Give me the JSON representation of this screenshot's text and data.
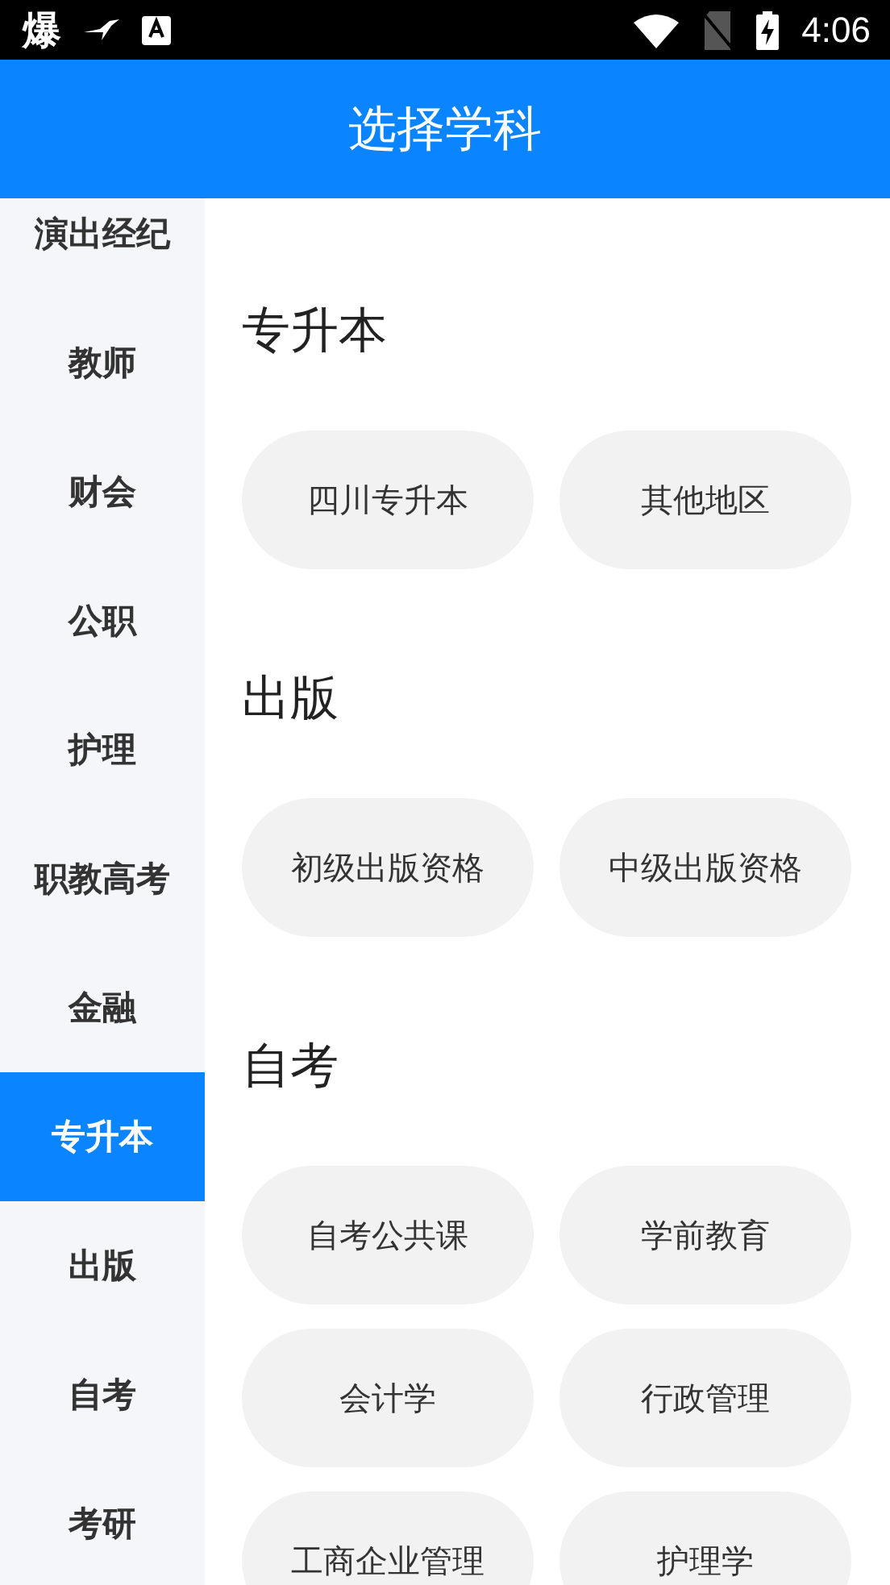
{
  "status_bar": {
    "notification_glyph": "爆",
    "time": "4:06"
  },
  "header": {
    "title": "选择学科"
  },
  "sidebar": {
    "items": [
      {
        "label": "演出经纪",
        "selected": false
      },
      {
        "label": "教师",
        "selected": false
      },
      {
        "label": "财会",
        "selected": false
      },
      {
        "label": "公职",
        "selected": false
      },
      {
        "label": "护理",
        "selected": false
      },
      {
        "label": "职教高考",
        "selected": false
      },
      {
        "label": "金融",
        "selected": false
      },
      {
        "label": "专升本",
        "selected": true
      },
      {
        "label": "出版",
        "selected": false
      },
      {
        "label": "自考",
        "selected": false
      },
      {
        "label": "考研",
        "selected": false
      }
    ]
  },
  "sections": [
    {
      "title": "专升本",
      "subjects": [
        "四川专升本",
        "其他地区"
      ]
    },
    {
      "title": "出版",
      "subjects": [
        "初级出版资格",
        "中级出版资格"
      ]
    },
    {
      "title": "自考",
      "subjects": [
        "自考公共课",
        "学前教育",
        "会计学",
        "行政管理",
        "工商企业管理",
        "护理学"
      ]
    }
  ]
}
